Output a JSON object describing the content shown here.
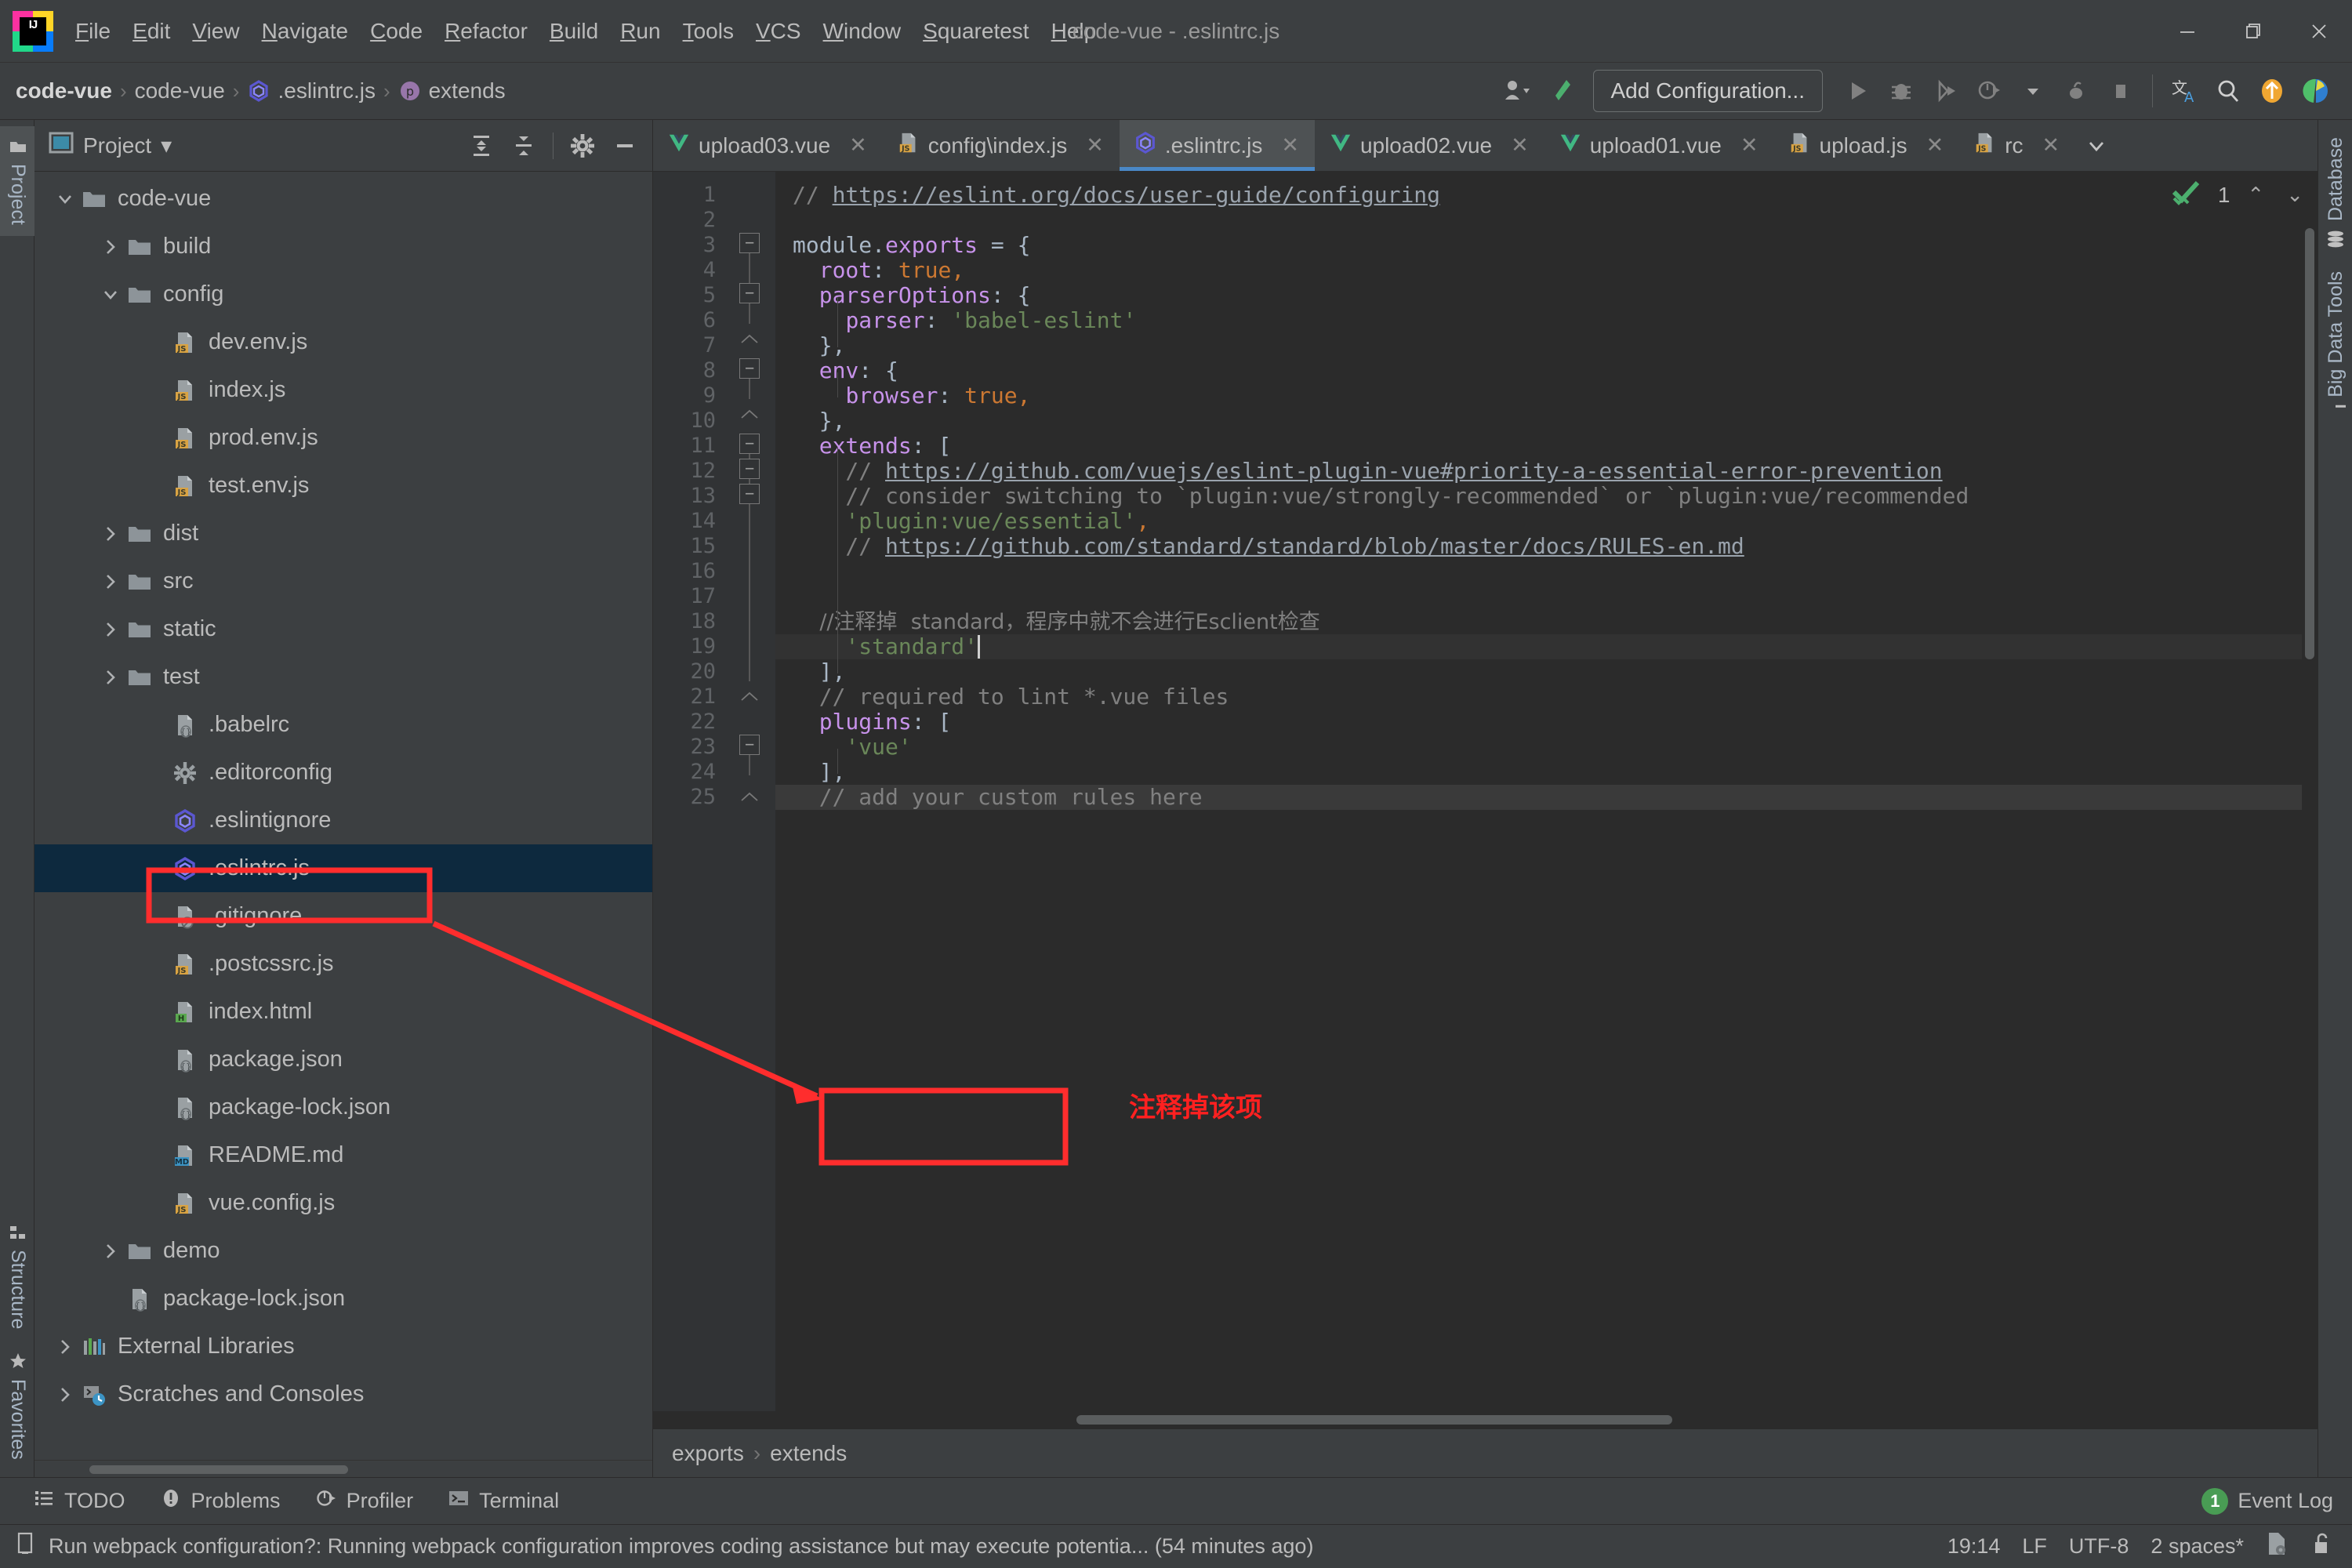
{
  "window": {
    "title": "code-vue - .eslintrc.js",
    "minimize": "—",
    "maximize": "❐",
    "close": "✕"
  },
  "menubar": {
    "items": [
      "File",
      "Edit",
      "View",
      "Navigate",
      "Code",
      "Refactor",
      "Build",
      "Run",
      "Tools",
      "VCS",
      "Window",
      "Squaretest",
      "Help"
    ]
  },
  "navbar": {
    "breadcrumbs": [
      {
        "label": "code-vue",
        "icon": "none",
        "bold": true
      },
      {
        "label": "code-vue",
        "icon": "none",
        "bold": false
      },
      {
        "label": ".eslintrc.js",
        "icon": "eslint-icon",
        "bold": false
      },
      {
        "label": "extends",
        "icon": "property-icon",
        "bold": false
      }
    ],
    "separator": "›",
    "add_configuration": "Add Configuration...",
    "icons": [
      "user-avatar-icon",
      "build-hammer-icon",
      "run-icon",
      "debug-icon",
      "run-coverage-icon",
      "profile-icon",
      "dropdown-arrow-icon",
      "attach-debugger-icon",
      "stop-icon",
      "translate-icon",
      "search-everywhere-icon",
      "update-project-icon",
      "ide-features-icon"
    ]
  },
  "left_strip": {
    "top": [
      {
        "label": "Project",
        "icon": "project-icon",
        "selected": true
      }
    ],
    "bottom": [
      {
        "label": "Structure",
        "icon": "structure-icon",
        "selected": false
      },
      {
        "label": "Favorites",
        "icon": "star-icon",
        "selected": false
      }
    ]
  },
  "right_strip": {
    "items": [
      {
        "label": "Database",
        "icon": "database-icon"
      },
      {
        "label": "Big Data Tools",
        "icon": "bigdata-icon"
      }
    ]
  },
  "project_panel": {
    "title": "Project",
    "title_dropdown": "▾",
    "tools": [
      "expand-all-icon",
      "collapse-all-icon",
      "settings-gear-icon",
      "hide-panel-icon"
    ],
    "tree": [
      {
        "label": "code-vue",
        "indent": 0,
        "arrow": "down",
        "icon": "folder",
        "selected": false
      },
      {
        "label": "build",
        "indent": 1,
        "arrow": "right",
        "icon": "folder",
        "selected": false
      },
      {
        "label": "config",
        "indent": 1,
        "arrow": "down",
        "icon": "folder",
        "selected": false
      },
      {
        "label": "dev.env.js",
        "indent": 2,
        "arrow": "none",
        "icon": "js",
        "selected": false
      },
      {
        "label": "index.js",
        "indent": 2,
        "arrow": "none",
        "icon": "js",
        "selected": false
      },
      {
        "label": "prod.env.js",
        "indent": 2,
        "arrow": "none",
        "icon": "js",
        "selected": false
      },
      {
        "label": "test.env.js",
        "indent": 2,
        "arrow": "none",
        "icon": "js",
        "selected": false
      },
      {
        "label": "dist",
        "indent": 1,
        "arrow": "right",
        "icon": "folder",
        "selected": false
      },
      {
        "label": "src",
        "indent": 1,
        "arrow": "right",
        "icon": "folder",
        "selected": false
      },
      {
        "label": "static",
        "indent": 1,
        "arrow": "right",
        "icon": "folder",
        "selected": false
      },
      {
        "label": "test",
        "indent": 1,
        "arrow": "right",
        "icon": "folder",
        "selected": false
      },
      {
        "label": ".babelrc",
        "indent": 2,
        "arrow": "none",
        "icon": "json",
        "selected": false
      },
      {
        "label": ".editorconfig",
        "indent": 2,
        "arrow": "none",
        "icon": "gear",
        "selected": false
      },
      {
        "label": ".eslintignore",
        "indent": 2,
        "arrow": "none",
        "icon": "eslint",
        "selected": false
      },
      {
        "label": ".eslintrc.js",
        "indent": 2,
        "arrow": "none",
        "icon": "eslint",
        "selected": true
      },
      {
        "label": ".gitignore",
        "indent": 2,
        "arrow": "none",
        "icon": "ignore",
        "selected": false
      },
      {
        "label": ".postcssrc.js",
        "indent": 2,
        "arrow": "none",
        "icon": "js",
        "selected": false
      },
      {
        "label": "index.html",
        "indent": 2,
        "arrow": "none",
        "icon": "html",
        "selected": false
      },
      {
        "label": "package.json",
        "indent": 2,
        "arrow": "none",
        "icon": "json",
        "selected": false
      },
      {
        "label": "package-lock.json",
        "indent": 2,
        "arrow": "none",
        "icon": "json",
        "selected": false
      },
      {
        "label": "README.md",
        "indent": 2,
        "arrow": "none",
        "icon": "md",
        "selected": false
      },
      {
        "label": "vue.config.js",
        "indent": 2,
        "arrow": "none",
        "icon": "js",
        "selected": false
      },
      {
        "label": "demo",
        "indent": 1,
        "arrow": "right",
        "icon": "folder",
        "selected": false
      },
      {
        "label": "package-lock.json",
        "indent": 1,
        "arrow": "none",
        "icon": "json",
        "selected": false
      },
      {
        "label": "External Libraries",
        "indent": 0,
        "arrow": "right",
        "icon": "libs",
        "selected": false
      },
      {
        "label": "Scratches and Consoles",
        "indent": 0,
        "arrow": "right",
        "icon": "scratch",
        "selected": false
      }
    ]
  },
  "editor": {
    "tabs": [
      {
        "label": "upload03.vue",
        "icon": "vue",
        "active": false
      },
      {
        "label": "config\\index.js",
        "icon": "js",
        "active": false
      },
      {
        "label": ".eslintrc.js",
        "icon": "eslint",
        "active": true
      },
      {
        "label": "upload02.vue",
        "icon": "vue",
        "active": false
      },
      {
        "label": "upload01.vue",
        "icon": "vue",
        "active": false
      },
      {
        "label": "upload.js",
        "icon": "js",
        "active": false
      },
      {
        "label": "rc",
        "icon": "js",
        "active": false
      }
    ],
    "tab_close": "✕",
    "tabs_more": "⌄",
    "inspection": {
      "count": "1",
      "up": "⌃",
      "down": "⌄",
      "icon": "inspection-ok-icon"
    },
    "breadcrumb": {
      "items": [
        "exports",
        "extends"
      ],
      "sep": "›"
    },
    "line_numbers": [
      "1",
      "2",
      "3",
      "4",
      "5",
      "6",
      "7",
      "8",
      "9",
      "10",
      "11",
      "12",
      "13",
      "14",
      "15",
      "16",
      "17",
      "18",
      "19",
      "20",
      "21",
      "22",
      "23",
      "24",
      "25"
    ],
    "code_lines": [
      {
        "n": 1,
        "segs": [
          {
            "t": "// ",
            "c": "cm"
          },
          {
            "t": "https://eslint.org/docs/user-guide/configuring",
            "c": "cmu"
          }
        ]
      },
      {
        "n": 2,
        "segs": []
      },
      {
        "n": 3,
        "segs": [
          {
            "t": "module",
            "c": "pl"
          },
          {
            "t": ".",
            "c": "punct"
          },
          {
            "t": "exports",
            "c": "prop"
          },
          {
            "t": " = {",
            "c": "punct"
          }
        ]
      },
      {
        "n": 4,
        "segs": [
          {
            "t": "  ",
            "c": "pl"
          },
          {
            "t": "root",
            "c": "prop"
          },
          {
            "t": ": ",
            "c": "punct"
          },
          {
            "t": "true",
            "c": "kw"
          },
          {
            "t": ",",
            "c": "kw"
          }
        ]
      },
      {
        "n": 5,
        "segs": [
          {
            "t": "  ",
            "c": "pl"
          },
          {
            "t": "parserOptions",
            "c": "prop"
          },
          {
            "t": ": {",
            "c": "punct"
          }
        ]
      },
      {
        "n": 6,
        "segs": [
          {
            "t": "    ",
            "c": "pl"
          },
          {
            "t": "parser",
            "c": "prop"
          },
          {
            "t": ": ",
            "c": "punct"
          },
          {
            "t": "'babel-eslint'",
            "c": "str"
          }
        ]
      },
      {
        "n": 7,
        "segs": [
          {
            "t": "  },",
            "c": "punct"
          }
        ]
      },
      {
        "n": 8,
        "segs": [
          {
            "t": "  ",
            "c": "pl"
          },
          {
            "t": "env",
            "c": "prop"
          },
          {
            "t": ": {",
            "c": "punct"
          }
        ]
      },
      {
        "n": 9,
        "segs": [
          {
            "t": "    ",
            "c": "pl"
          },
          {
            "t": "browser",
            "c": "prop"
          },
          {
            "t": ": ",
            "c": "punct"
          },
          {
            "t": "true",
            "c": "kw"
          },
          {
            "t": ",",
            "c": "kw"
          }
        ]
      },
      {
        "n": 10,
        "segs": [
          {
            "t": "  },",
            "c": "punct"
          }
        ]
      },
      {
        "n": 11,
        "segs": [
          {
            "t": "  ",
            "c": "pl"
          },
          {
            "t": "extends",
            "c": "prop"
          },
          {
            "t": ": [",
            "c": "punct"
          }
        ]
      },
      {
        "n": 12,
        "segs": [
          {
            "t": "    // ",
            "c": "cm"
          },
          {
            "t": "https://github.com/vuejs/eslint-plugin-vue#priority-a-essential-error-prevention",
            "c": "cmu"
          }
        ]
      },
      {
        "n": 13,
        "segs": [
          {
            "t": "    // consider switching to `plugin:vue/strongly-recommended` or `plugin:vue/recommended",
            "c": "cm"
          }
        ]
      },
      {
        "n": 14,
        "segs": [
          {
            "t": "    ",
            "c": "pl"
          },
          {
            "t": "'plugin:vue/essential'",
            "c": "str"
          },
          {
            "t": ",",
            "c": "kw"
          }
        ]
      },
      {
        "n": 15,
        "segs": [
          {
            "t": "    // ",
            "c": "cm"
          },
          {
            "t": "https://github.com/standard/standard/blob/master/docs/RULES-en.md",
            "c": "cmu"
          }
        ]
      },
      {
        "n": 16,
        "segs": []
      },
      {
        "n": 17,
        "segs": []
      },
      {
        "n": 18,
        "segs": [
          {
            "t": "    //注释掉  standard，程序中就不会进行Esclient检查",
            "c": "cm"
          }
        ]
      },
      {
        "n": 19,
        "segs": [
          {
            "t": "    ",
            "c": "pl"
          },
          {
            "t": "'standard'",
            "c": "str"
          }
        ]
      },
      {
        "n": 20,
        "segs": [
          {
            "t": "  ],",
            "c": "punct"
          }
        ]
      },
      {
        "n": 21,
        "segs": [
          {
            "t": "  // required to lint *.vue files",
            "c": "cm"
          }
        ]
      },
      {
        "n": 22,
        "segs": [
          {
            "t": "  ",
            "c": "pl"
          },
          {
            "t": "plugins",
            "c": "prop"
          },
          {
            "t": ": [",
            "c": "punct"
          }
        ]
      },
      {
        "n": 23,
        "segs": [
          {
            "t": "    ",
            "c": "pl"
          },
          {
            "t": "'vue'",
            "c": "str"
          }
        ]
      },
      {
        "n": 24,
        "segs": [
          {
            "t": "  ],",
            "c": "punct"
          }
        ]
      },
      {
        "n": 25,
        "segs": [
          {
            "t": "  // add your custom rules here",
            "c": "cm"
          }
        ]
      }
    ]
  },
  "annotations": {
    "sidebar_box_label": "",
    "code_box_label": "",
    "note_text": "注释掉该项",
    "color": "#ff2020"
  },
  "tool_window_bar": {
    "tabs": [
      {
        "label": "TODO",
        "icon": "todo-icon"
      },
      {
        "label": "Problems",
        "icon": "problems-icon"
      },
      {
        "label": "Profiler",
        "icon": "profiler-icon"
      },
      {
        "label": "Terminal",
        "icon": "terminal-icon"
      }
    ],
    "event_log": {
      "label": "Event Log",
      "count": "1"
    }
  },
  "statusbar": {
    "message": "Run webpack configuration?: Running webpack configuration improves coding assistance but may execute potentia... (54 minutes ago)",
    "message_icon": "notification-icon",
    "time": "19:14",
    "line_separator": "LF",
    "encoding": "UTF-8",
    "indent": "2 spaces*",
    "indent_icon": "indent-config-icon",
    "lock_icon": "unlocked-icon"
  }
}
